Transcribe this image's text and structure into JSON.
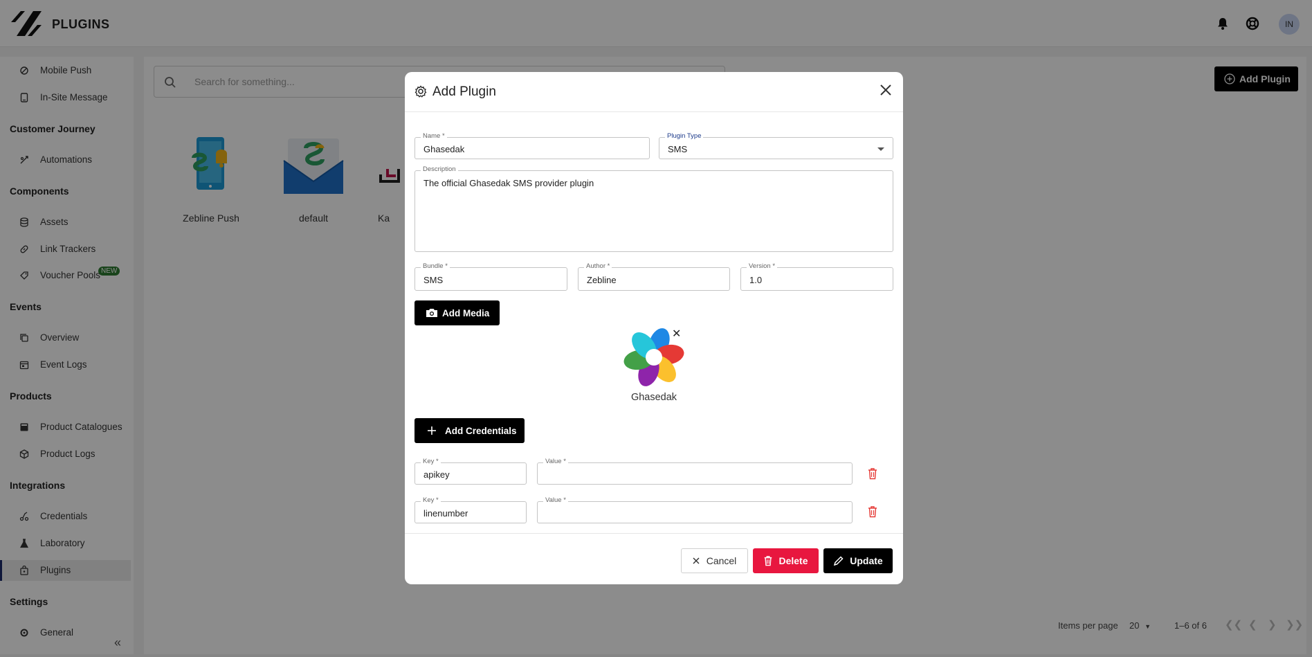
{
  "app": {
    "title": "PLUGINS",
    "avatar_initials": "IN"
  },
  "header": {
    "icons": [
      "bell-icon",
      "help-lifebuoy-icon"
    ]
  },
  "sidebar": {
    "items_top": [
      {
        "label": "Mobile Push",
        "icon": "mobile-push-icon"
      },
      {
        "label": "In-Site Message",
        "icon": "in-site-message-icon"
      }
    ],
    "sections": {
      "customer_journey": "Customer Journey",
      "components": "Components",
      "events": "Events",
      "products": "Products",
      "integrations": "Integrations",
      "settings": "Settings"
    },
    "items": {
      "automations": "Automations",
      "assets": "Assets",
      "link_trackers": "Link Trackers",
      "voucher_pools": "Voucher Pools",
      "voucher_badge": "NEW",
      "overview": "Overview",
      "event_logs": "Event Logs",
      "product_catalogues": "Product Catalogues",
      "product_logs": "Product Logs",
      "credentials": "Credentials",
      "laboratory": "Laboratory",
      "plugins": "Plugins",
      "general": "General"
    }
  },
  "main": {
    "search_placeholder": "Search for something...",
    "add_plugin_label": "Add Plugin",
    "cards": [
      {
        "name": "Zebline Push"
      },
      {
        "name": "default"
      },
      {
        "name": "Ka"
      }
    ],
    "pagination": {
      "items_per_page_label": "Items per page",
      "items_per_page_value": "20",
      "range": "1–6 of 6"
    }
  },
  "modal": {
    "title": "Add Plugin",
    "name": {
      "label": "Name *",
      "value": "Ghasedak"
    },
    "plugin_type": {
      "label": "Plugin Type",
      "value": "SMS"
    },
    "description": {
      "label": "Description",
      "value": "The official Ghasedak SMS provider plugin"
    },
    "bundle": {
      "label": "Bundle *",
      "value": "SMS"
    },
    "author": {
      "label": "Author *",
      "value": "Zebline"
    },
    "version": {
      "label": "Version *",
      "value": "1.0"
    },
    "add_media_label": "Add Media",
    "media_name": "Ghasedak",
    "media_remove": "✕",
    "add_credentials_label": "Add Credentials",
    "credentials": [
      {
        "key_label": "Key *",
        "key": "apikey",
        "value_label": "Value *",
        "value": ""
      },
      {
        "key_label": "Key *",
        "key": "linenumber",
        "value_label": "Value *",
        "value": ""
      }
    ],
    "cancel_label": "Cancel",
    "delete_label": "Delete",
    "update_label": "Update"
  },
  "colors": {
    "primary": "#000000",
    "danger": "#e8173f",
    "active_nav": "#1c2b6b"
  }
}
